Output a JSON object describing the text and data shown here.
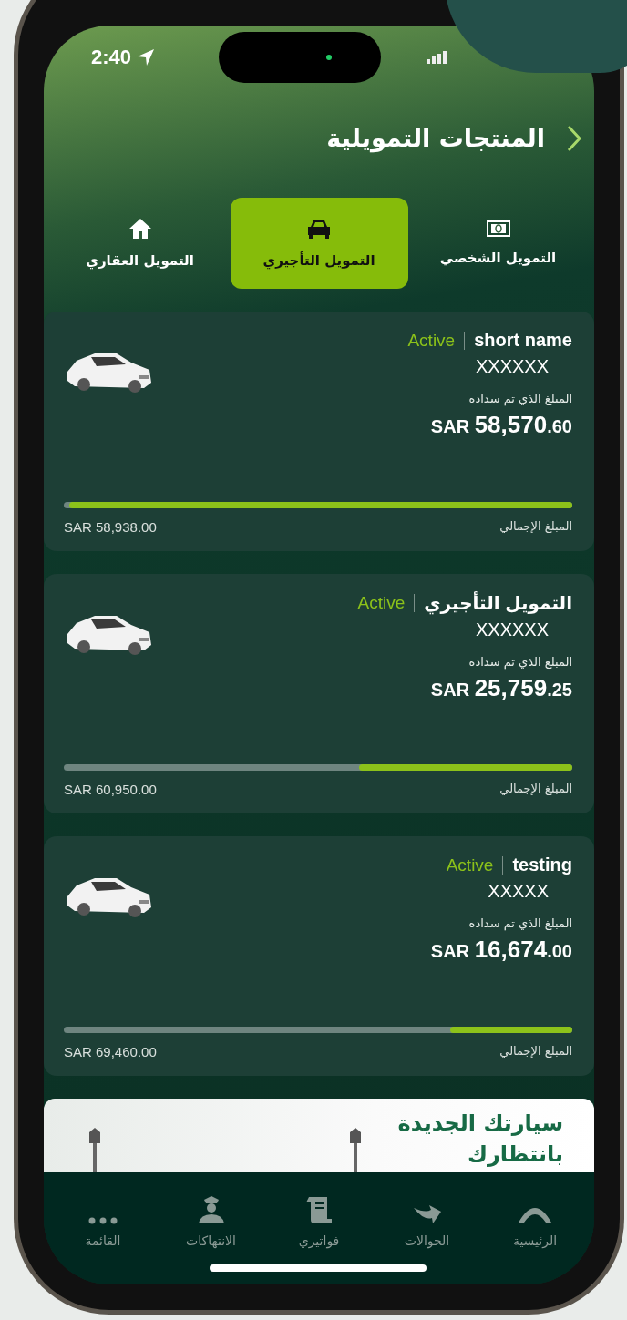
{
  "status_bar": {
    "time": "2:40"
  },
  "header": {
    "title": "المنتجات التمويلية"
  },
  "tabs": [
    {
      "label": "التمويل الشخصي",
      "kind": "cash",
      "selected": false
    },
    {
      "label": "التمويل التأجيري",
      "kind": "car",
      "selected": true
    },
    {
      "label": "التمويل العقاري",
      "kind": "house",
      "selected": false
    }
  ],
  "cards": [
    {
      "name": "short name",
      "status": "Active",
      "account": "XXXXXX",
      "paid_label": "المبلغ الذي تم سداده",
      "currency": "SAR",
      "amount": "58,570",
      "decimals": ".60",
      "level": 0.99,
      "total_label": "المبلغ الإجمالي",
      "total": "SAR 58,938.00"
    },
    {
      "name": "التمويل التأجيري",
      "status": "Active",
      "account": "XXXXXX",
      "paid_label": "المبلغ الذي تم سداده",
      "currency": "SAR",
      "amount": "25,759",
      "decimals": ".25",
      "level": 0.42,
      "total_label": "المبلغ الإجمالي",
      "total": "SAR 60,950.00"
    },
    {
      "name": "testing",
      "status": "Active",
      "account": "XXXXX",
      "paid_label": "المبلغ الذي تم سداده",
      "currency": "SAR",
      "amount": "16,674",
      "decimals": ".00",
      "level": 0.24,
      "total_label": "المبلغ الإجمالي",
      "total": "SAR 69,460.00"
    }
  ],
  "banner": {
    "text": "سيارتك الجديدة بانتظارك"
  },
  "nav": [
    {
      "label": "الرئيسية",
      "kind": "home"
    },
    {
      "label": "الحوالات",
      "kind": "transfer"
    },
    {
      "label": "فواتيري",
      "kind": "bill"
    },
    {
      "label": "الانتهاكات",
      "kind": "officer"
    },
    {
      "label": "القائمة",
      "kind": "more"
    }
  ]
}
